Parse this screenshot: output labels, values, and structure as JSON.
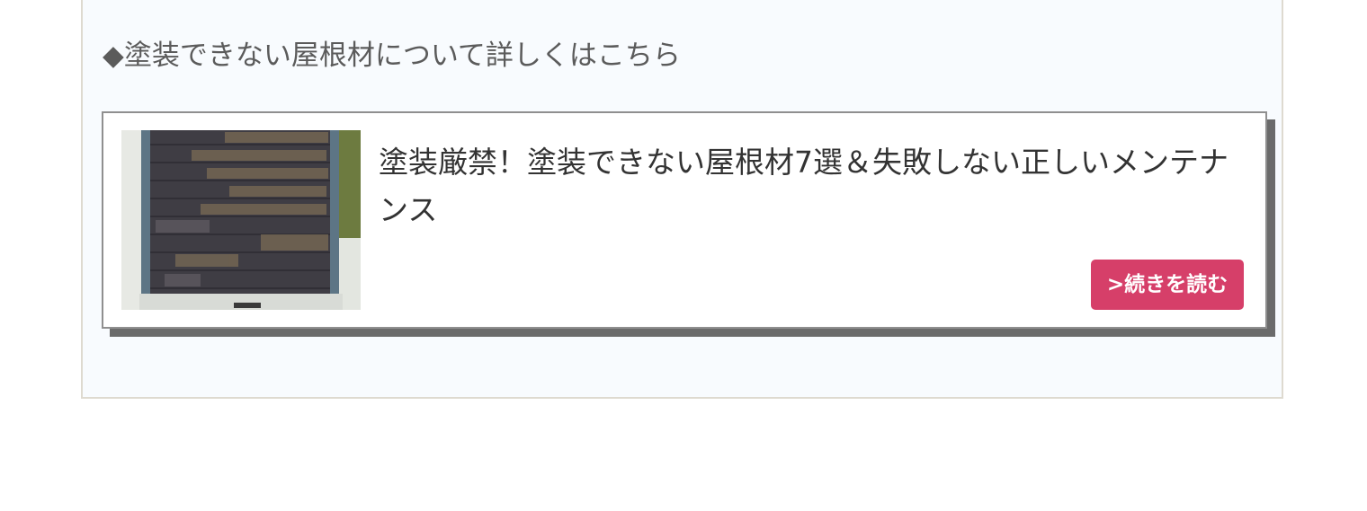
{
  "section": {
    "heading": "◆塗装できない屋根材について詳しくはこちら"
  },
  "card": {
    "title": "塗装厳禁！塗装できない屋根材7選＆失敗しない正しいメンテナンス",
    "read_more_label": ">続きを読む",
    "thumbnail_icon": "roof-photo-icon"
  },
  "colors": {
    "box_background": "#f8fbfe",
    "box_border": "#dedad0",
    "button": "#d63f69",
    "shadow": "#6b6b6b"
  }
}
